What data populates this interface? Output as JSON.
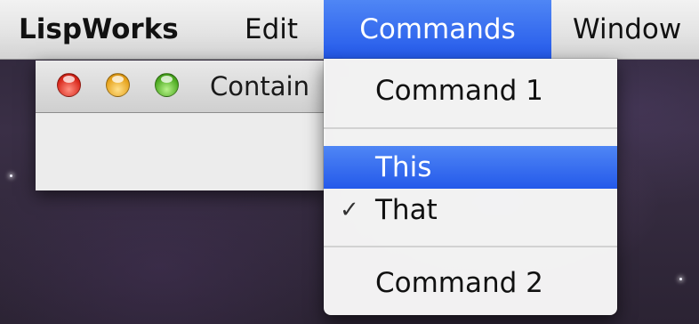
{
  "menubar": {
    "app": "LispWorks",
    "edit": "Edit",
    "commands": "Commands",
    "window": "Window"
  },
  "window": {
    "title": "Contain"
  },
  "dropdown": {
    "items": [
      {
        "label": "Command 1",
        "checked": false,
        "highlighted": false
      },
      {
        "label": "This",
        "checked": false,
        "highlighted": true
      },
      {
        "label": "That",
        "checked": true,
        "highlighted": false
      },
      {
        "label": "Command 2",
        "checked": false,
        "highlighted": false
      }
    ],
    "check_glyph": "✓"
  },
  "colors": {
    "highlight": "#2c62ee",
    "menubar": "#e4e4e4"
  }
}
